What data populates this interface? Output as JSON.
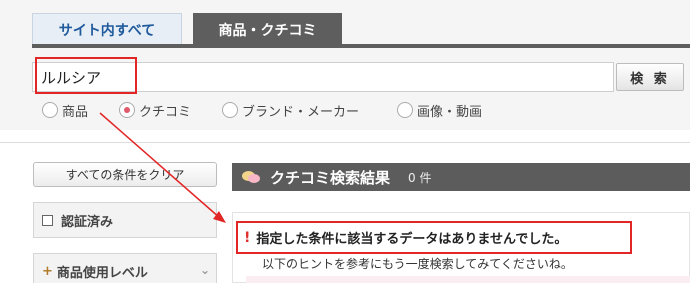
{
  "tabs": [
    {
      "label": "サイト内すべて",
      "active": false
    },
    {
      "label": "商品・クチコミ",
      "active": true
    }
  ],
  "search": {
    "value": "ルルシア",
    "button_label": "検 索"
  },
  "search_type": {
    "options": [
      "商品",
      "クチコミ",
      "ブランド・メーカー",
      "画像・動画"
    ],
    "selected": "クチコミ"
  },
  "sidebar": {
    "clear_button": "すべての条件をクリア",
    "certified_label": "認証済み",
    "usage_level_label": "商品使用レベル"
  },
  "results": {
    "title": "クチコミ検索結果",
    "count": "0 件",
    "no_results_message": "指定した条件に該当するデータはありませんでした。",
    "hint": "以下のヒントを参考にもう一度検索してみてくださいね。"
  },
  "colors": {
    "annotation_red": "#e22626",
    "active_tab": "#5e5e5e",
    "inactive_tab_text": "#1f5a9c",
    "radio_selected": "#e05a6a"
  }
}
